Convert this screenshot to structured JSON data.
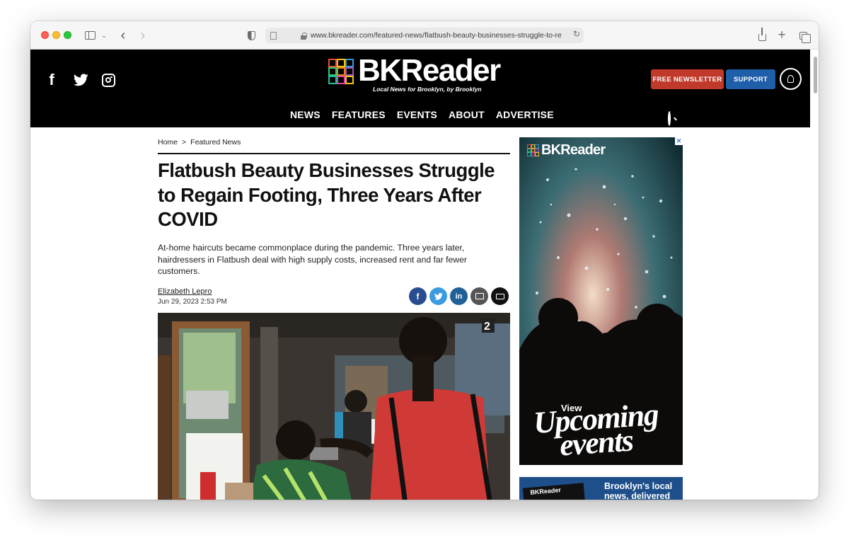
{
  "browser": {
    "url": "www.bkreader.com/featured-news/flatbush-beauty-businesses-struggle-to-re"
  },
  "header": {
    "logo_text": "BKReader",
    "tagline": "Local News for Brooklyn, by Brooklyn",
    "newsletter_label": "FREE NEWSLETTER",
    "support_label": "SUPPORT",
    "nav": [
      "NEWS",
      "FEATURES",
      "EVENTS",
      "ABOUT",
      "ADVERTISE"
    ],
    "icons": [
      "facebook-icon",
      "twitter-icon",
      "instagram-icon",
      "account-icon",
      "search-icon"
    ]
  },
  "article": {
    "breadcrumb": [
      "Home",
      ">",
      "Featured News"
    ],
    "headline": "Flatbush Beauty Businesses Struggle to Regain Footing, Three Years After COVID",
    "dek": "At-home haircuts became commonplace during the pandemic. Three years later, hairdressers in Flatbush deal with high supply costs, increased rent and far fewer customers.",
    "author": "Elizabeth Lepro",
    "date": "Jun 29, 2023 2:53 PM",
    "share_icons": [
      "facebook-icon",
      "twitter-icon",
      "linkedin-icon",
      "email-icon",
      "print-icon"
    ]
  },
  "ad": {
    "logo_text": "BKReader",
    "view": "View",
    "line1": "Upcoming",
    "line2": "events"
  },
  "ad2": {
    "mini_logo": "BKReader",
    "text1": "Brooklyn's local",
    "text2": "news, delivered"
  },
  "colors": {
    "header_bg": "#000000",
    "newsletter": "#c0392b",
    "support": "#1f5ea8"
  }
}
